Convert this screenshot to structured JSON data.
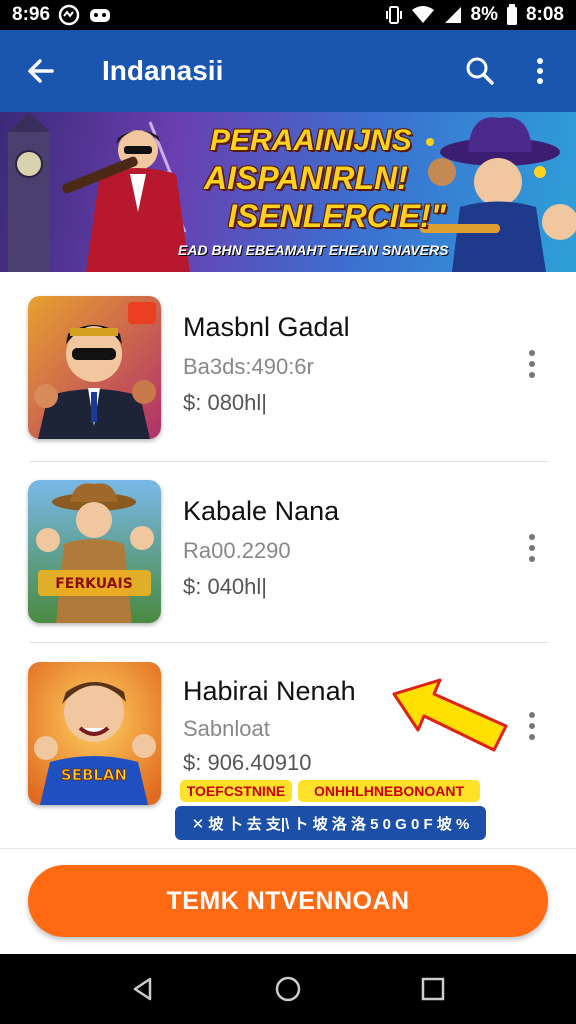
{
  "status_bar": {
    "time_left": "8:96",
    "time_right": "8:08",
    "battery": "8%"
  },
  "app_bar": {
    "title": "Indanasii"
  },
  "banner": {
    "line1": "PERAAINIJNS",
    "line2": "AISPANIRLN!",
    "line3": "ISENLERCIE!\"",
    "subtitle": "EAD BHN EBEAMAHT EHEAN SNAVERS"
  },
  "items": [
    {
      "name": "Masbnl Gadal",
      "subtitle": "Ba3ds:490:6r",
      "price": "$: 080hl|"
    },
    {
      "name": "Kabale Nana",
      "subtitle": "Ra00.2290",
      "price": "$: 040hl|"
    },
    {
      "name": "Habirai Nenah",
      "subtitle": "Sabnloat",
      "price": "$: 906.40910"
    }
  ],
  "tags": {
    "tag_a": "TOEFCSTNINE",
    "tag_b": "ONHHLHNEBONOANT"
  },
  "promo_chip": "✕ 坡 卜 去 支|\\ ト 坡 洛 洛 5 0 G 0 F 坡 % ",
  "thumbnail_captions": {
    "item2": "FERKUAIS",
    "item3": "SEBLAN"
  },
  "cta": {
    "label": "TEMK NTVENNOAN"
  },
  "colors": {
    "app_bar": "#1a56b0",
    "cta": "#ff6a13",
    "arrow": "#ffe000",
    "tag": "#ffe12a"
  }
}
